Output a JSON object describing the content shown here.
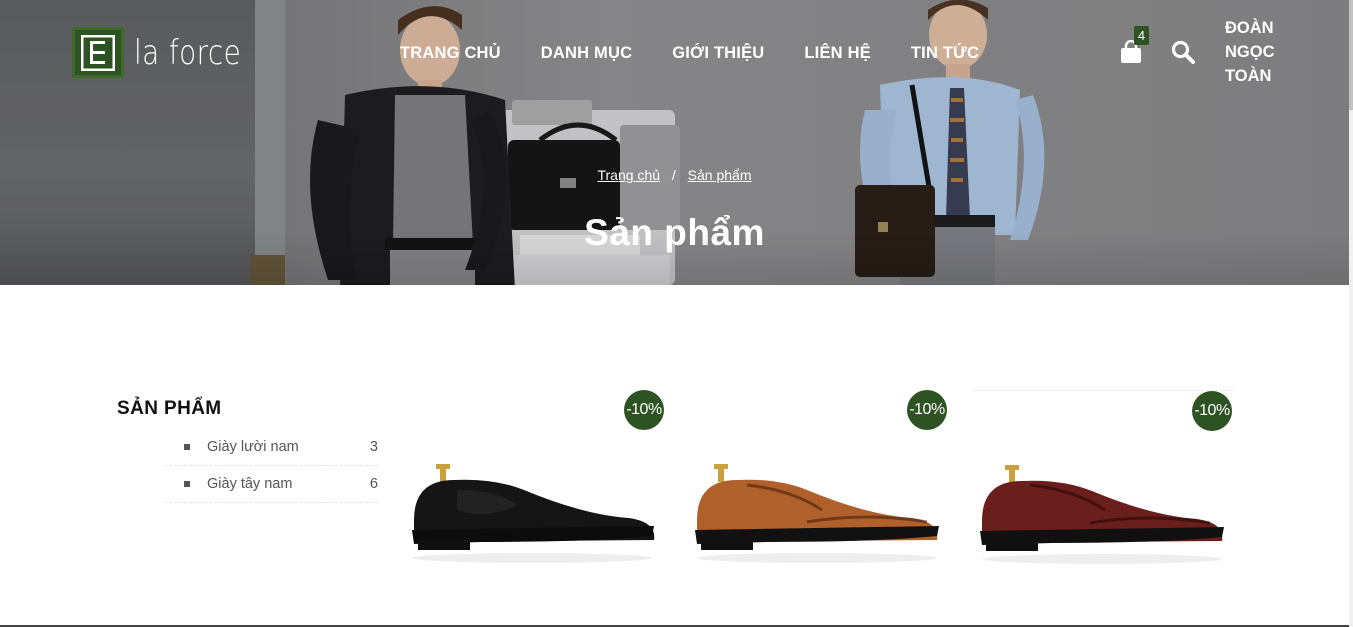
{
  "brand": {
    "name": "la force",
    "accent": "#2d5322"
  },
  "nav": {
    "items": [
      {
        "label": "TRANG CHỦ"
      },
      {
        "label": "DANH MỤC"
      },
      {
        "label": "GIỚI THIỆU"
      },
      {
        "label": "LIÊN HỆ"
      },
      {
        "label": "TIN TỨC"
      }
    ]
  },
  "header": {
    "cart_icon": "shopping-bag-icon",
    "cart_count": "4",
    "search_icon": "search-icon",
    "user_name": "ĐOÀN NGỌC TOÀN"
  },
  "hero": {
    "breadcrumb": {
      "home": "Trang chủ",
      "separator": "/",
      "current": "Sản phẩm"
    },
    "title": "Sản phẩm"
  },
  "sidebar": {
    "title": "SẢN PHẨM",
    "categories": [
      {
        "label": "Giày lười nam",
        "count": "3"
      },
      {
        "label": "Giày tây nam",
        "count": "6"
      }
    ]
  },
  "products": [
    {
      "discount": "-10%",
      "color": "#151515"
    },
    {
      "discount": "-10%",
      "color": "#b0602a"
    },
    {
      "discount": "-10%",
      "color": "#6b1f1c"
    }
  ]
}
